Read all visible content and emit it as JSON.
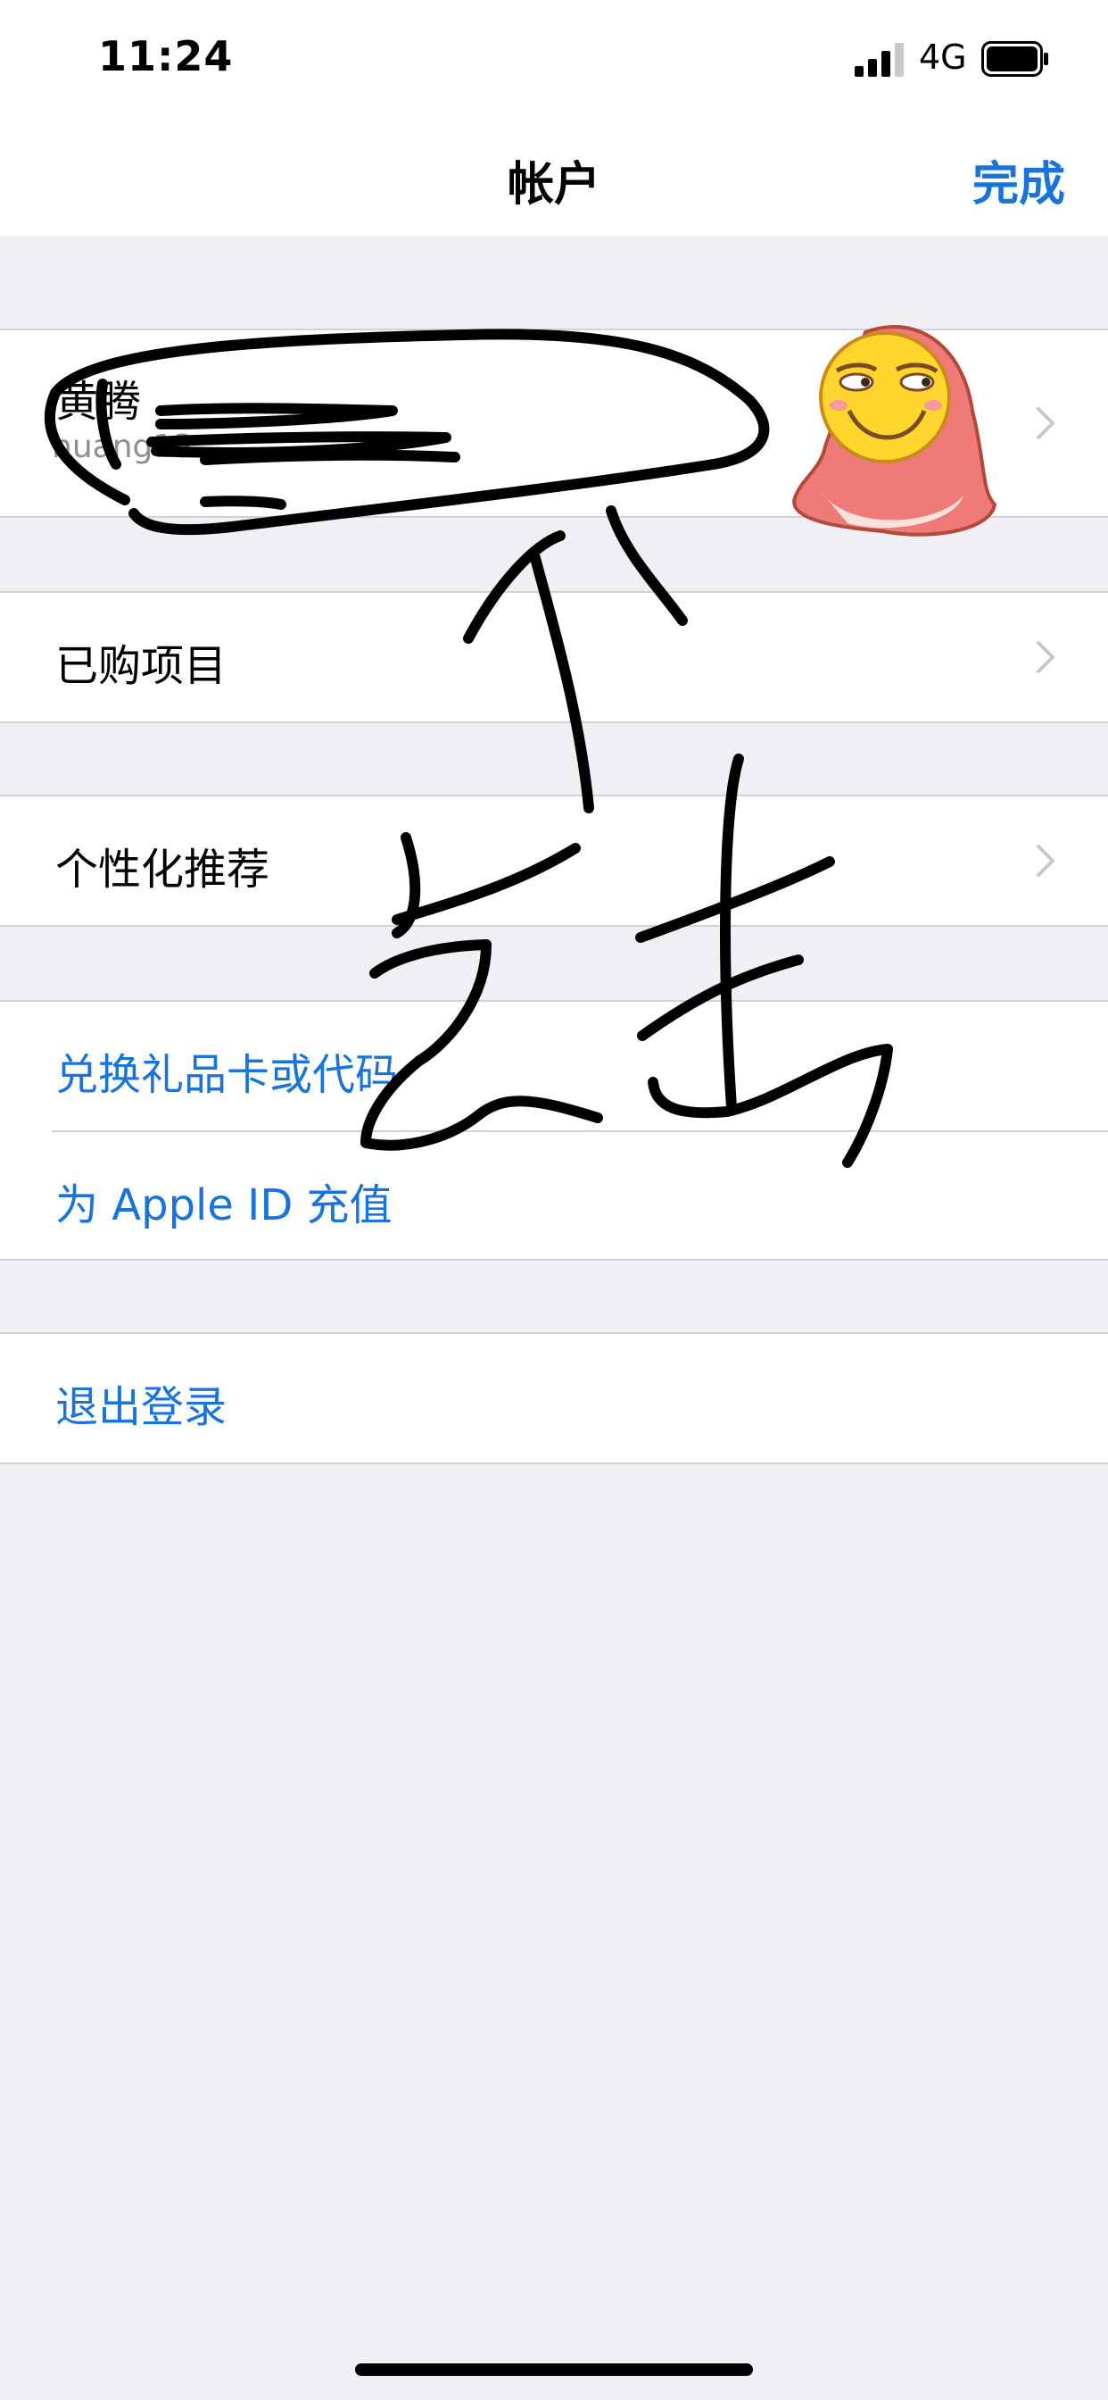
{
  "status_bar": {
    "time": "11:24",
    "network": "4G"
  },
  "nav": {
    "title": "帐户",
    "done_label": "完成"
  },
  "profile": {
    "name": "黄腾",
    "email": "huang13"
  },
  "menu": {
    "purchased": "已购项目",
    "personalized": "个性化推荐",
    "redeem": "兑换礼品卡或代码",
    "add_funds": "为 Apple ID 充值",
    "sign_out": "退出登录"
  },
  "colors": {
    "accent": "#1a73d9",
    "background": "#efeff4",
    "separator": "#d1d1d6"
  }
}
